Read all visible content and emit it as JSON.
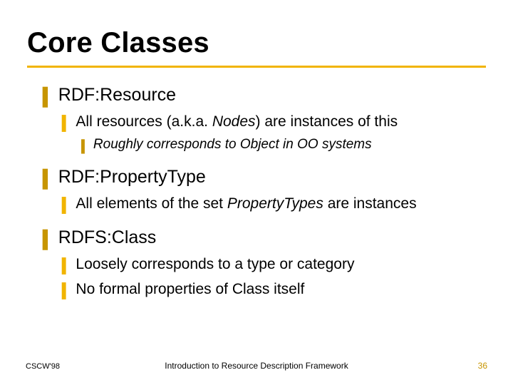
{
  "title": "Core Classes",
  "items": [
    {
      "heading": "RDF:Resource",
      "sub": [
        {
          "pre": "All resources (a.k.a. ",
          "em": "Nodes",
          "post": ") are instances of this",
          "sub": [
            {
              "text": "Roughly corresponds to Object in OO systems"
            }
          ]
        }
      ]
    },
    {
      "heading": "RDF:PropertyType",
      "sub": [
        {
          "pre": "All elements of the set ",
          "em": "PropertyTypes",
          "post": " are instances"
        }
      ]
    },
    {
      "heading": "RDFS:Class",
      "sub": [
        {
          "pre": "Loosely corresponds to a type or category",
          "em": "",
          "post": ""
        },
        {
          "pre": "No formal properties of Class itself",
          "em": "",
          "post": ""
        }
      ]
    }
  ],
  "footer": {
    "left": "CSCW'98",
    "center": "Introduction to Resource Description Framework",
    "right": "36"
  },
  "bullets": {
    "l1": "❚",
    "l2": "❚",
    "l3": "❚"
  }
}
